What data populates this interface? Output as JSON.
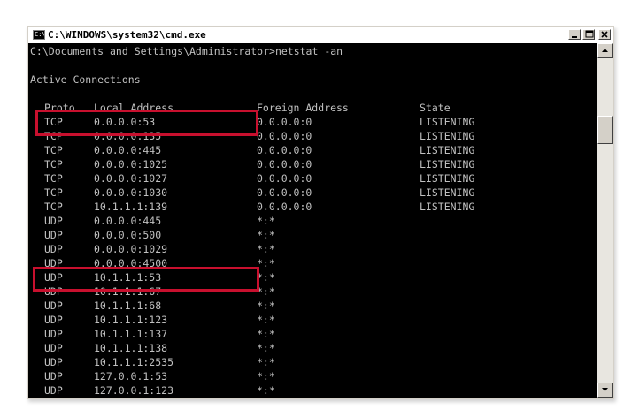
{
  "window": {
    "title": "C:\\WINDOWS\\system32\\cmd.exe",
    "icon_label": "C:\\"
  },
  "console": {
    "prompt_line": "C:\\Documents and Settings\\Administrator>netstat -an",
    "section_title": "Active Connections",
    "headers": {
      "proto": "Proto",
      "local": "Local Address",
      "foreign": "Foreign Address",
      "state": "State"
    },
    "rows": [
      {
        "proto": "TCP",
        "local": "0.0.0.0:53",
        "foreign": "0.0.0.0:0",
        "state": "LISTENING"
      },
      {
        "proto": "TCP",
        "local": "0.0.0.0:135",
        "foreign": "0.0.0.0:0",
        "state": "LISTENING"
      },
      {
        "proto": "TCP",
        "local": "0.0.0.0:445",
        "foreign": "0.0.0.0:0",
        "state": "LISTENING"
      },
      {
        "proto": "TCP",
        "local": "0.0.0.0:1025",
        "foreign": "0.0.0.0:0",
        "state": "LISTENING"
      },
      {
        "proto": "TCP",
        "local": "0.0.0.0:1027",
        "foreign": "0.0.0.0:0",
        "state": "LISTENING"
      },
      {
        "proto": "TCP",
        "local": "0.0.0.0:1030",
        "foreign": "0.0.0.0:0",
        "state": "LISTENING"
      },
      {
        "proto": "TCP",
        "local": "10.1.1.1:139",
        "foreign": "0.0.0.0:0",
        "state": "LISTENING"
      },
      {
        "proto": "UDP",
        "local": "0.0.0.0:445",
        "foreign": "*:*",
        "state": ""
      },
      {
        "proto": "UDP",
        "local": "0.0.0.0:500",
        "foreign": "*:*",
        "state": ""
      },
      {
        "proto": "UDP",
        "local": "0.0.0.0:1029",
        "foreign": "*:*",
        "state": ""
      },
      {
        "proto": "UDP",
        "local": "0.0.0.0:4500",
        "foreign": "*:*",
        "state": ""
      },
      {
        "proto": "UDP",
        "local": "10.1.1.1:53",
        "foreign": "*:*",
        "state": ""
      },
      {
        "proto": "UDP",
        "local": "10.1.1.1:67",
        "foreign": "*:*",
        "state": ""
      },
      {
        "proto": "UDP",
        "local": "10.1.1.1:68",
        "foreign": "*:*",
        "state": ""
      },
      {
        "proto": "UDP",
        "local": "10.1.1.1:123",
        "foreign": "*:*",
        "state": ""
      },
      {
        "proto": "UDP",
        "local": "10.1.1.1:137",
        "foreign": "*:*",
        "state": ""
      },
      {
        "proto": "UDP",
        "local": "10.1.1.1:138",
        "foreign": "*:*",
        "state": ""
      },
      {
        "proto": "UDP",
        "local": "10.1.1.1:2535",
        "foreign": "*:*",
        "state": ""
      },
      {
        "proto": "UDP",
        "local": "127.0.0.1:53",
        "foreign": "*:*",
        "state": ""
      },
      {
        "proto": "UDP",
        "local": "127.0.0.1:123",
        "foreign": "*:*",
        "state": ""
      }
    ]
  },
  "colors": {
    "console_background": "#000000",
    "console_text": "#c0c0c0",
    "highlight": "#c8102e",
    "window_frame": "#d4d0c8"
  },
  "icons": {
    "minimize": "minimize-icon",
    "maximize": "maximize-icon",
    "close": "close-icon",
    "scroll_up": "arrow-up-icon",
    "scroll_down": "arrow-down-icon"
  }
}
